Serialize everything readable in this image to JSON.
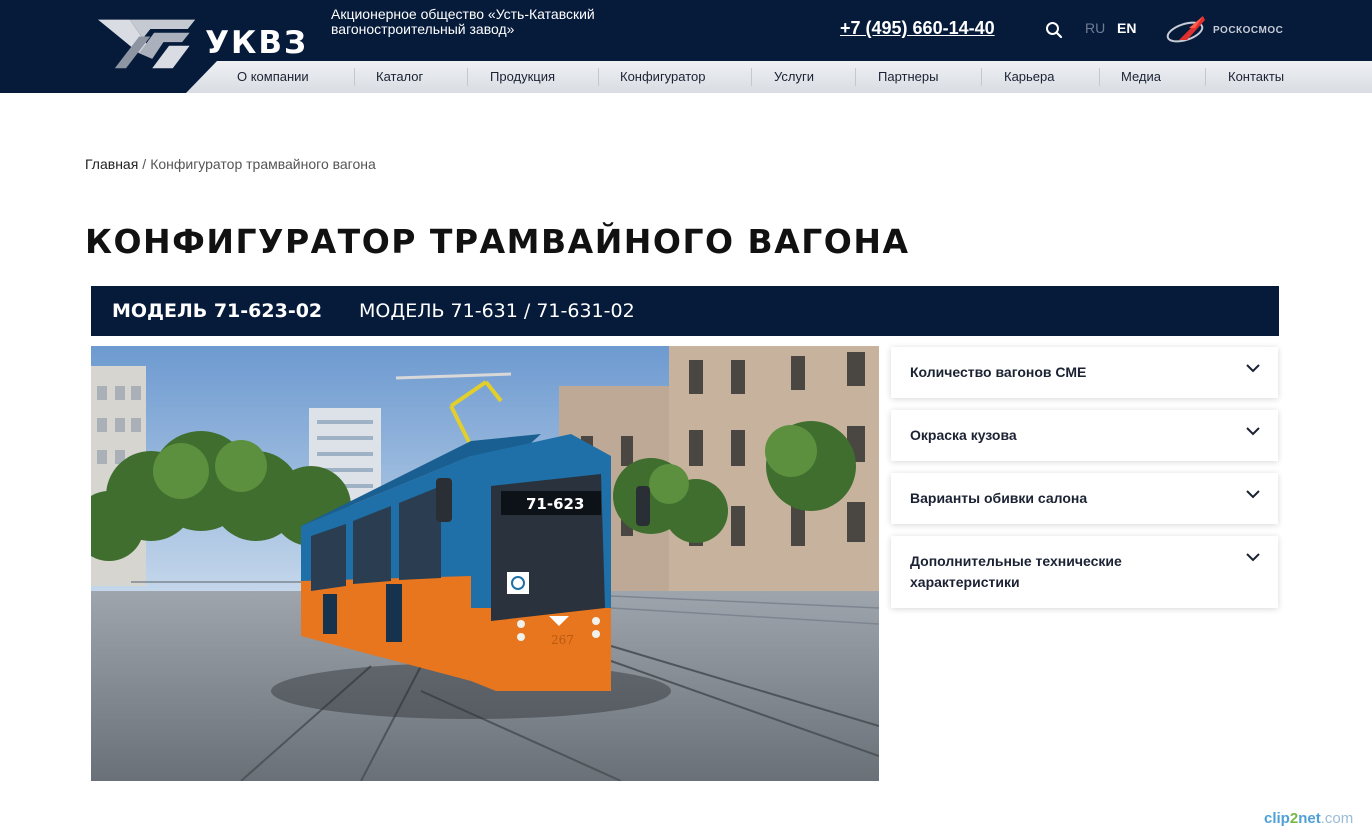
{
  "header": {
    "logo_text": "УКВЗ",
    "company_name": "Акционерное общество «Усть-Катавский вагоностроительный завод»",
    "phone": "+7 (495) 660-14-40",
    "search_icon": "search-icon",
    "lang_ru": "RU",
    "lang_en": "EN",
    "partner_logo_text": "РОСКОСМОС"
  },
  "nav": {
    "items": [
      {
        "label": "О компании"
      },
      {
        "label": "Каталог"
      },
      {
        "label": "Продукция"
      },
      {
        "label": "Конфигуратор"
      },
      {
        "label": "Услуги"
      },
      {
        "label": "Партнеры"
      },
      {
        "label": "Карьера"
      },
      {
        "label": "Медиа"
      },
      {
        "label": "Контакты"
      }
    ]
  },
  "breadcrumb": {
    "home": "Главная",
    "separator": "/",
    "current": "Конфигуратор трамвайного вагона"
  },
  "page_title": "КОНФИГУРАТОР ТРАМВАЙНОГО ВАГОНА",
  "tabs": [
    {
      "label": "МОДЕЛЬ 71-623-02",
      "active": true
    },
    {
      "label": "МОДЕЛЬ 71-631 / 71-631-02",
      "active": false
    }
  ],
  "tram": {
    "route_display": "71-623",
    "fleet_number": "267",
    "body_colors": {
      "upper": "#1f6fa8",
      "lower": "#e8761e"
    }
  },
  "options": [
    {
      "label": "Количество вагонов СМЕ",
      "icon": "chevron-down-icon"
    },
    {
      "label": "Окраска кузова",
      "icon": "chevron-down-icon"
    },
    {
      "label": "Варианты обивки салона",
      "icon": "chevron-down-icon"
    },
    {
      "label": "Дополнительные технические характеристики",
      "icon": "chevron-down-icon"
    }
  ],
  "watermark": {
    "a": "clip",
    "b": "2",
    "c": "net",
    "d": ".com"
  },
  "colors": {
    "navy": "#061a3a",
    "nav_bg": "#e6e9ed",
    "accent_red": "#e0302e"
  }
}
